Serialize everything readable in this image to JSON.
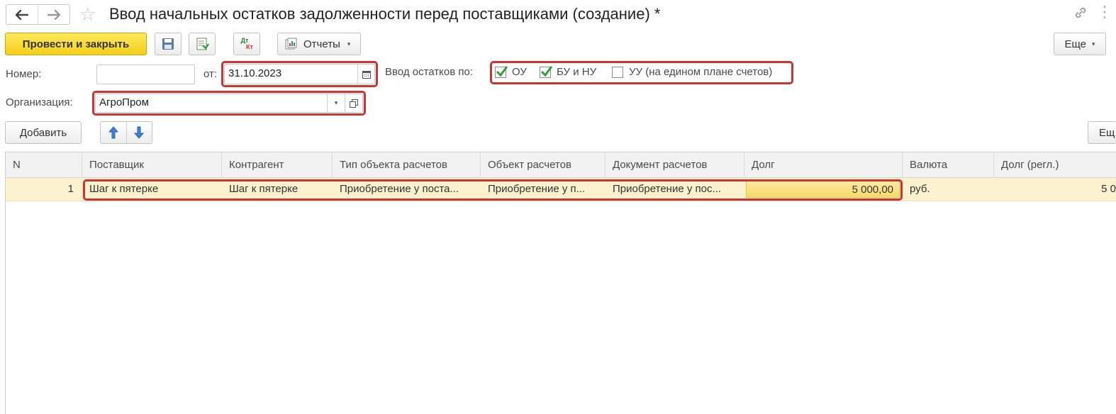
{
  "window": {
    "title": "Ввод начальных остатков задолженности перед поставщиками (создание) *"
  },
  "toolbar": {
    "post_close_label": "Провести и закрыть",
    "dtkt_top": "Дт",
    "dtkt_bottom": "Кт",
    "reports_label": "Отчеты",
    "more_label": "Еще"
  },
  "form": {
    "number_label": "Номер:",
    "number_value": "",
    "date_label": "от:",
    "date_value": "31.10.2023",
    "balances_label": "Ввод остатков по:",
    "checkboxes": [
      {
        "label": "ОУ",
        "checked": true
      },
      {
        "label": "БУ и НУ",
        "checked": true
      },
      {
        "label": "УУ (на едином плане счетов)",
        "checked": false
      }
    ],
    "org_label": "Организация:",
    "org_value": "АгроПром"
  },
  "table_toolbar": {
    "add_label": "Добавить",
    "more_label": "Ещ"
  },
  "table": {
    "columns": [
      "N",
      "Поставщик",
      "Контрагент",
      "Тип объекта расчетов",
      "Объект расчетов",
      "Документ расчетов",
      "Долг",
      "Валюта",
      "Долг (регл.)"
    ],
    "rows": [
      {
        "n": "1",
        "supplier": "Шаг к пятерке",
        "counterparty": "Шаг к пятерке",
        "settlement_type": "Приобретение у поста...",
        "settlement_object": "Приобретение у п...",
        "settlement_doc": "Приобретение у пос...",
        "debt": "5 000,00",
        "currency": "руб.",
        "debt_regl": "5 0"
      }
    ]
  },
  "colors": {
    "primary_button": "#f4cf1a",
    "highlight_border": "#cc3333",
    "selected_row": "#fbf1cd",
    "check_mark": "#3a9a3a"
  }
}
